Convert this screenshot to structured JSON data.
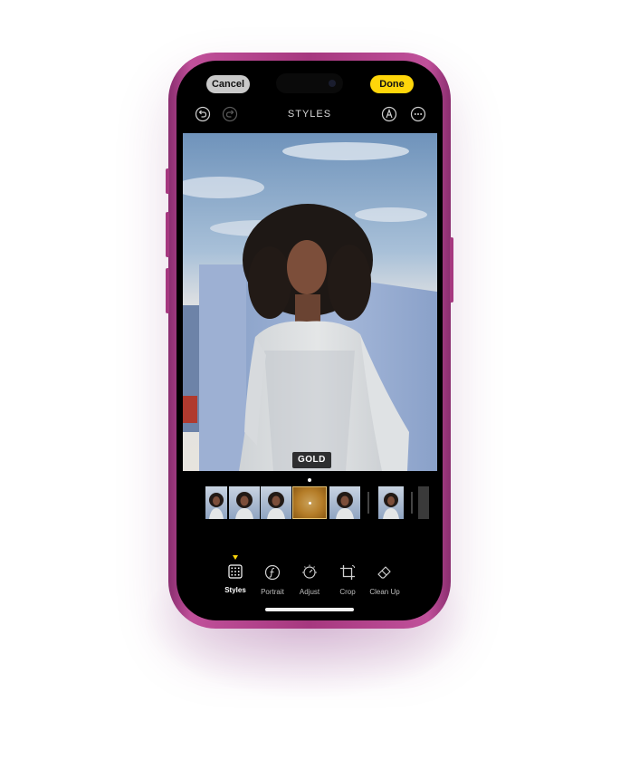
{
  "topbar": {
    "cancel_label": "Cancel",
    "done_label": "Done",
    "title": "STYLES",
    "icons": [
      "undo-icon",
      "redo-icon",
      "markup-icon",
      "more-icon"
    ]
  },
  "photo": {
    "style_label": "GOLD"
  },
  "style_strip": {
    "selected": "GOLD",
    "accent": "#ffd60a"
  },
  "toolbar": {
    "items": [
      {
        "label": "Styles",
        "icon": "styles-grid-icon",
        "active": true
      },
      {
        "label": "Portrait",
        "icon": "aperture-f-icon",
        "active": false
      },
      {
        "label": "Adjust",
        "icon": "adjust-dial-icon",
        "active": false
      },
      {
        "label": "Crop",
        "icon": "crop-icon",
        "active": false
      },
      {
        "label": "Clean Up",
        "icon": "eraser-icon",
        "active": false
      }
    ]
  },
  "colors": {
    "frame": "#a6387f",
    "done_button": "#ffd60a",
    "cancel_button": "#c9c9c9",
    "screen": "#000000"
  }
}
